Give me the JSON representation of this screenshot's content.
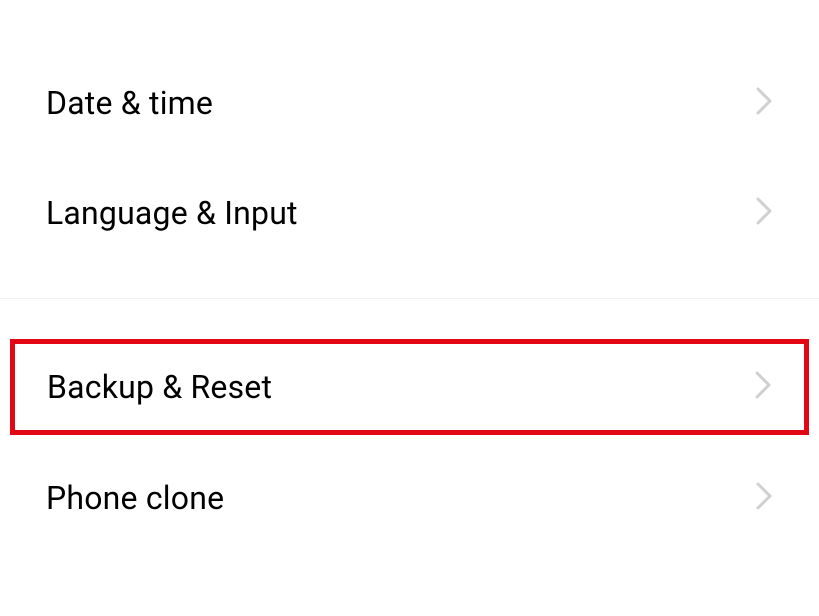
{
  "settings": {
    "items": [
      {
        "label": "Date & time",
        "highlighted": false
      },
      {
        "label": "Language & Input",
        "highlighted": false
      },
      {
        "label": "Backup & Reset",
        "highlighted": true
      },
      {
        "label": "Phone clone",
        "highlighted": false
      }
    ]
  },
  "colors": {
    "highlight": "#e30613",
    "chevron": "#d0d0d0",
    "text": "#000000",
    "divider": "#f2f2f2"
  }
}
